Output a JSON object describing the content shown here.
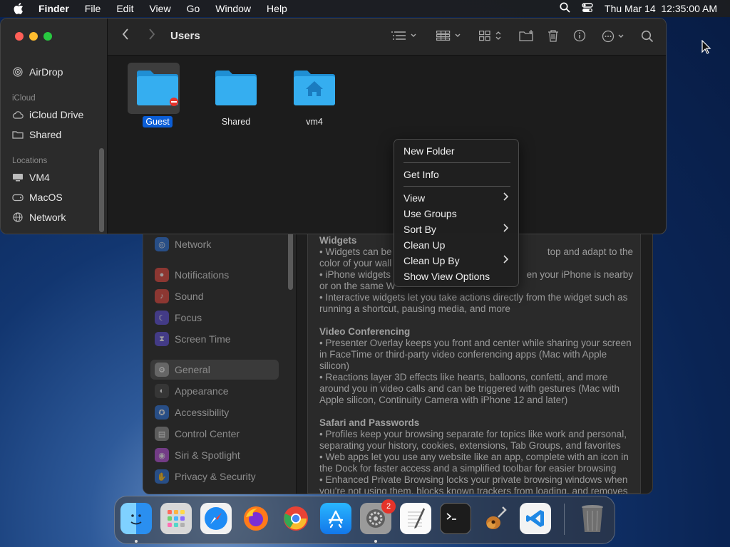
{
  "menubar": {
    "app_name": "Finder",
    "items": [
      "File",
      "Edit",
      "View",
      "Go",
      "Window",
      "Help"
    ],
    "datetime": "Thu Mar 14  12:35:00 AM"
  },
  "finder": {
    "title": "Users",
    "sidebar": {
      "airdrop": "AirDrop",
      "icloud_section": "iCloud",
      "icloud_drive": "iCloud Drive",
      "shared": "Shared",
      "locations_section": "Locations",
      "loc_vm4": "VM4",
      "loc_macos": "MacOS",
      "loc_network": "Network"
    },
    "folders": [
      {
        "name": "Guest",
        "selected": true,
        "badge": "restricted"
      },
      {
        "name": "Shared",
        "selected": false
      },
      {
        "name": "vm4",
        "selected": false,
        "badge": "home"
      }
    ],
    "folder_color": "#35aef0"
  },
  "context_menu": {
    "items": [
      {
        "label": "New Folder"
      },
      {
        "label": "Get Info"
      },
      {
        "label": "View",
        "submenu": true
      },
      {
        "label": "Use Groups"
      },
      {
        "label": "Sort By",
        "submenu": true
      },
      {
        "label": "Clean Up"
      },
      {
        "label": "Clean Up By",
        "submenu": true
      },
      {
        "label": "Show View Options"
      }
    ]
  },
  "settings": {
    "sidebar": [
      "Network",
      "Notifications",
      "Sound",
      "Focus",
      "Screen Time",
      "General",
      "Appearance",
      "Accessibility",
      "Control Center",
      "Siri & Spotlight",
      "Privacy & Security"
    ],
    "selected": "General",
    "content": {
      "h1": "Widgets",
      "p1a": "• Widgets can be",
      "p1a_tail": "top and adapt to the",
      "p1b": "color of your wall",
      "p1c": "• iPhone widgets",
      "p1c_tail": "en your iPhone is nearby",
      "p1d": "or on the same W",
      "p1e": "• Interactive widgets let you take actions directly from the widget such as running a shortcut, pausing media, and more",
      "h2": "Video Conferencing",
      "p2a": "• Presenter Overlay keeps you front and center while sharing your screen in FaceTime or third-party video conferencing apps (Mac with Apple silicon)",
      "p2b": "• Reactions layer 3D effects like hearts, balloons, confetti, and more around you in video calls and can be triggered with gestures (Mac with Apple silicon, Continuity Camera with iPhone 12 and later)",
      "h3": "Safari and Passwords",
      "p3a": "• Profiles keep your browsing separate for topics like work and personal, separating your history, cookies, extensions, Tab Groups, and favorites",
      "p3b": "• Web apps let you use any website like an app, complete with an icon in the Dock for faster access and a simplified toolbar for easier browsing",
      "p3c": "• Enhanced Private Browsing locks your private browsing windows when you're not using them, blocks known trackers from loading, and removes"
    }
  },
  "dock": {
    "apps": [
      "Finder",
      "Launchpad",
      "Safari",
      "Firefox",
      "Chrome",
      "App Store",
      "System Settings",
      "TextEdit",
      "Terminal",
      "GarageBand",
      "Visual Studio Code",
      "Trash"
    ],
    "settings_badge": "2"
  }
}
